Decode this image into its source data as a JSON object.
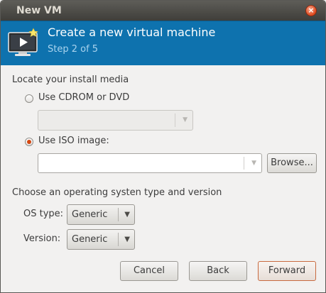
{
  "window": {
    "title": "New VM",
    "close_glyph": "×"
  },
  "header": {
    "title": "Create a new virtual machine",
    "step": "Step 2 of 5",
    "icon": "vm-monitor-icon",
    "bg_color": "#0e72ae"
  },
  "install_media": {
    "section_label": "Locate your install media",
    "cdrom_label": "Use CDROM or DVD",
    "cdrom_selected": false,
    "iso_label": "Use ISO image:",
    "iso_selected": true,
    "iso_path_value": "",
    "browse_label": "Browse..."
  },
  "os": {
    "section_label": "Choose an operating systen type and version",
    "type_label": "OS type:",
    "type_value": "Generic",
    "version_label": "Version:",
    "version_value": "Generic"
  },
  "buttons": {
    "cancel": "Cancel",
    "back": "Back",
    "forward": "Forward"
  }
}
